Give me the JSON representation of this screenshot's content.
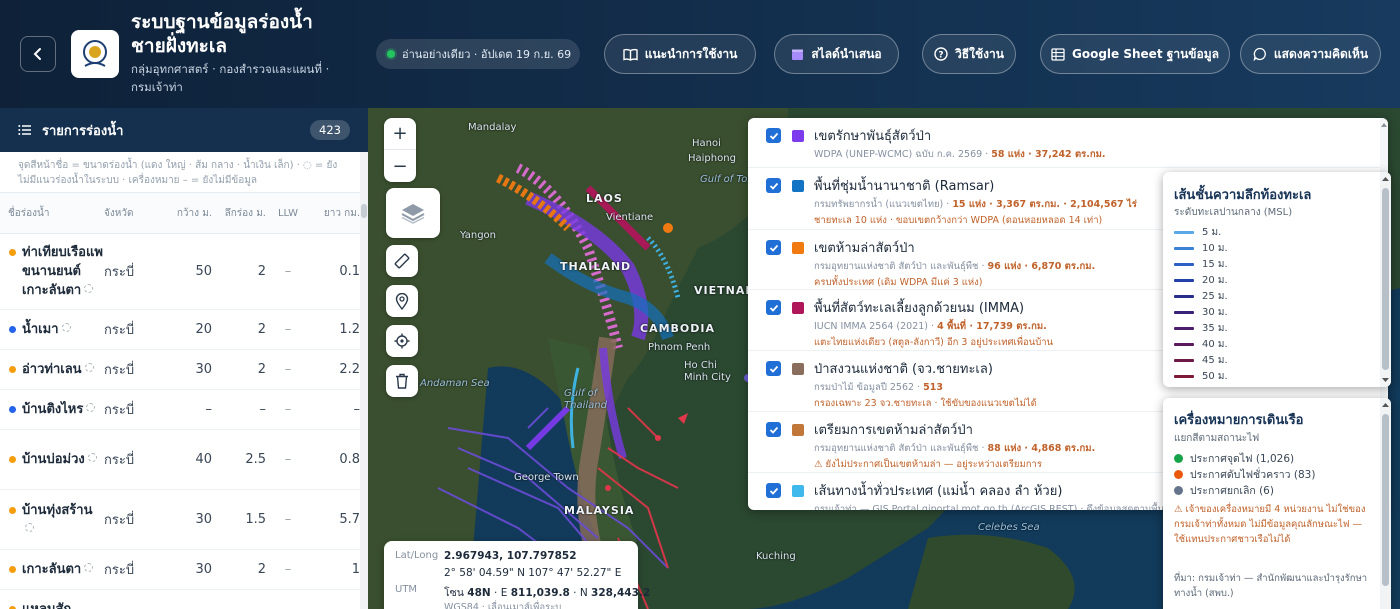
{
  "header": {
    "title": "ระบบฐานข้อมูลร่องน้ำชายฝั่งทะเล",
    "subtitle": "กลุ่มอุทกศาสตร์ · กองสำรวจและแผนที่ · กรมเจ้าท่า",
    "status": "อ่านอย่างเดียว · อัปเดต 19 ก.ย. 69",
    "buttons": {
      "guide": "แนะนำการใช้งาน",
      "slides": "สไลด์นำเสนอ",
      "howto": "วิธีใช้งาน",
      "sheet": "Google Sheet ฐานข้อมูล",
      "feedback": "แสดงความคิดเห็น"
    },
    "colors": {
      "accent": "#13304f",
      "status": "#22c55e"
    }
  },
  "sidebar": {
    "title": "รายการร่องน้ำ",
    "count": "423",
    "note": "จุดสีหน้าชื่อ = ขนาดร่องน้ำ (แดง ใหญ่ · ส้ม กลาง · น้ำเงิน เล็ก) · ◌ = ยังไม่มีแนวร่องน้ำในระบบ · เครื่องหมาย – = ยังไม่มีข้อมูล",
    "columns": [
      "ชื่อร่องน้ำ",
      "จังหวัด",
      "กว้าง ม.",
      "ลึกร่อง ม.",
      "LLW",
      "ยาว กม."
    ],
    "rows": [
      {
        "name": "ท่าเทียบเรือแพขนานยนต์เกาะลันตา",
        "province": "กระบี่",
        "width": "50",
        "depth": "2",
        "llw": "–",
        "length": "0.1",
        "size": "#f59e0b"
      },
      {
        "name": "น้ำเมา",
        "province": "กระบี่",
        "width": "20",
        "depth": "2",
        "llw": "–",
        "length": "1.2",
        "size": "#2563eb"
      },
      {
        "name": "อ่าวท่าเลน",
        "province": "กระบี่",
        "width": "30",
        "depth": "2",
        "llw": "–",
        "length": "2.2",
        "size": "#f59e0b"
      },
      {
        "name": "บ้านติงไหร",
        "province": "กระบี่",
        "width": "–",
        "depth": "–",
        "llw": "–",
        "length": "–",
        "size": "#2563eb"
      },
      {
        "name": "บ้านบ่อม่วง",
        "province": "กระบี่",
        "width": "40",
        "depth": "2.5",
        "llw": "–",
        "length": "0.8",
        "size": "#f59e0b"
      },
      {
        "name": "บ้านทุ่งสร้าน",
        "province": "กระบี่",
        "width": "30",
        "depth": "1.5",
        "llw": "–",
        "length": "5.7",
        "size": "#f59e0b"
      },
      {
        "name": "เกาะลันตา",
        "province": "กระบี่",
        "width": "30",
        "depth": "2",
        "llw": "–",
        "length": "1",
        "size": "#f59e0b"
      },
      {
        "name": "แหลมสัก",
        "province": "",
        "width": "",
        "depth": "",
        "llw": "",
        "length": "",
        "size": "#f59e0b"
      }
    ]
  },
  "map": {
    "places": {
      "mandalay": "Mandalay",
      "hanoi": "Hanoi",
      "haiphong": "Haiphong",
      "gulf_tonkin": "Gulf of Tonkin",
      "laos": "LAOS",
      "vientiane": "Vientiane",
      "yangon": "Yangon",
      "thailand": "THAILAND",
      "vietnam": "VIETNAM",
      "cambodia": "CAMBODIA",
      "phnom_penh": "Phnom Penh",
      "hcmc": "Ho Chi Minh City",
      "andaman": "Andaman Sea",
      "gulf_thailand": "Gulf of Thailand",
      "george_town": "George Town",
      "malaysia": "MALAYSIA",
      "kuching": "Kuching",
      "celebes": "Celebes Sea"
    },
    "controls": {
      "zoom_in": "+",
      "zoom_out": "−"
    },
    "coords": {
      "latlong_label": "Lat/Long",
      "latlong_value": "2.967943, 107.797852",
      "dms_value": "2° 58' 04.59\" N 107° 47' 52.27\" E",
      "utm_label": "UTM",
      "utm_zone_label": "โซน",
      "utm_zone": "48N",
      "utm_e_label": "· E",
      "utm_e": "811,039.8",
      "utm_n_label": "· N",
      "utm_n": "328,443.2",
      "datum_text": "WGS84 · เลื่อนเมาส์เพื่อระบุ"
    }
  },
  "layers": [
    {
      "title": "เขตรักษาพันธุ์สัตว์ป่า",
      "color": "#7c3aed",
      "src": "WDPA (UNEP-WCMC) ฉบับ ก.ค. 2569 ·",
      "stat": "58 แห่ง · 37,242 ตร.กม.",
      "note": ""
    },
    {
      "title": "พื้นที่ชุ่มน้ำนานาชาติ (Ramsar)",
      "color": "#1272c4",
      "src": "กรมทรัพยากรน้ำ (แนวเขตไทย) ·",
      "stat": "15 แห่ง · 3,367 ตร.กม. · 2,104,567 ไร่",
      "note": "ชายทะเล 10 แห่ง · ขอบเขตกว้างกว่า WDPA (ดอนหอยหลอด 14 เท่า)"
    },
    {
      "title": "เขตห้ามล่าสัตว์ป่า",
      "color": "#f07a10",
      "src": "กรมอุทยานแห่งชาติ สัตว์ป่า และพันธุ์พืช ·",
      "stat": "96 แห่ง · 6,870 ตร.กม.",
      "note": "ครบทั้งประเทศ (เดิม WDPA มีแค่ 3 แห่ง)"
    },
    {
      "title": "พื้นที่สัตว์ทะเลเลี้ยงลูกด้วยนม (IMMA)",
      "color": "#b0175a",
      "src": "IUCN IMMA 2564 (2021) ·",
      "stat": "4 พื้นที่ · 17,739 ตร.กม.",
      "note": "แตะไทยแห่งเดียว (สตูล-ลังกาวี) อีก 3 อยู่ประเทศเพื่อนบ้าน"
    },
    {
      "title": "ป่าสงวนแห่งชาติ (จว.ชายทะเล)",
      "color": "#8a6d5c",
      "src": "กรมป่าไม้ ข้อมูลปี 2562 ·",
      "stat": "513",
      "note": "กรองเฉพาะ 23 จว.ชายทะเล · ใช้ขับของแนวเขตไม่ได้"
    },
    {
      "title": "เตรียมการเขตห้ามล่าสัตว์ป่า",
      "color": "#c2773a",
      "src": "กรมอุทยานแห่งชาติ สัตว์ป่า และพันธุ์พืช ·",
      "stat": "88 แห่ง · 4,868 ตร.กม.",
      "note": "⚠ ยังไม่ประกาศเป็นเขตห้ามล่า — อยู่ระหว่างเตรียมการ"
    },
    {
      "title": "เส้นทางน้ำทั่วประเทศ (แม่น้ำ คลอง ลำ ห้วย)",
      "color": "#3fb8ec",
      "src": "กรมเจ้าท่า — GIS Portal giportal.mot.go.th (ArcGIS REST) · ดึงข้อมูลสดตามพื้นที่",
      "stat": "",
      "note": ""
    }
  ],
  "depth_legend": {
    "title": "เส้นชั้นความลึกท้องทะเล",
    "subtitle": "ระดับทะเลปานกลาง (MSL)",
    "items": [
      {
        "label": "5 ม.",
        "color": "#5aa9e6"
      },
      {
        "label": "10 ม.",
        "color": "#3b82d6"
      },
      {
        "label": "15 ม.",
        "color": "#2d5fc4"
      },
      {
        "label": "20 ม.",
        "color": "#233fa8"
      },
      {
        "label": "25 ม.",
        "color": "#262e8a"
      },
      {
        "label": "30 ม.",
        "color": "#3b2278"
      },
      {
        "label": "35 ม.",
        "color": "#4c1d6b"
      },
      {
        "label": "40 ม.",
        "color": "#5a1a5c"
      },
      {
        "label": "45 ม.",
        "color": "#6d1a48"
      },
      {
        "label": "50 ม.",
        "color": "#7f1a36"
      }
    ]
  },
  "nav_legend": {
    "title": "เครื่องหมายการเดินเรือ",
    "subtitle": "แยกสีตามสถานะไฟ",
    "items": [
      {
        "label": "ประกาศจุดไฟ (1,026)",
        "color": "#16a34a"
      },
      {
        "label": "ประกาศดับไฟชั่วคราว (83)",
        "color": "#ea580c"
      },
      {
        "label": "ประกาศยกเลิก (6)",
        "color": "#64748b"
      }
    ],
    "warning": "⚠ เจ้าของเครื่องหมายมี 4 หน่วยงาน ไม่ใช่ของกรมเจ้าท่าทั้งหมด ไม่มีข้อมูลคุณลักษณะไฟ — ใช้แทนประกาศชาวเรือไม่ได้",
    "source": "ที่มา: กรมเจ้าท่า — สำนักพัฒนาและบำรุงรักษาทางน้ำ (สพบ.)"
  }
}
